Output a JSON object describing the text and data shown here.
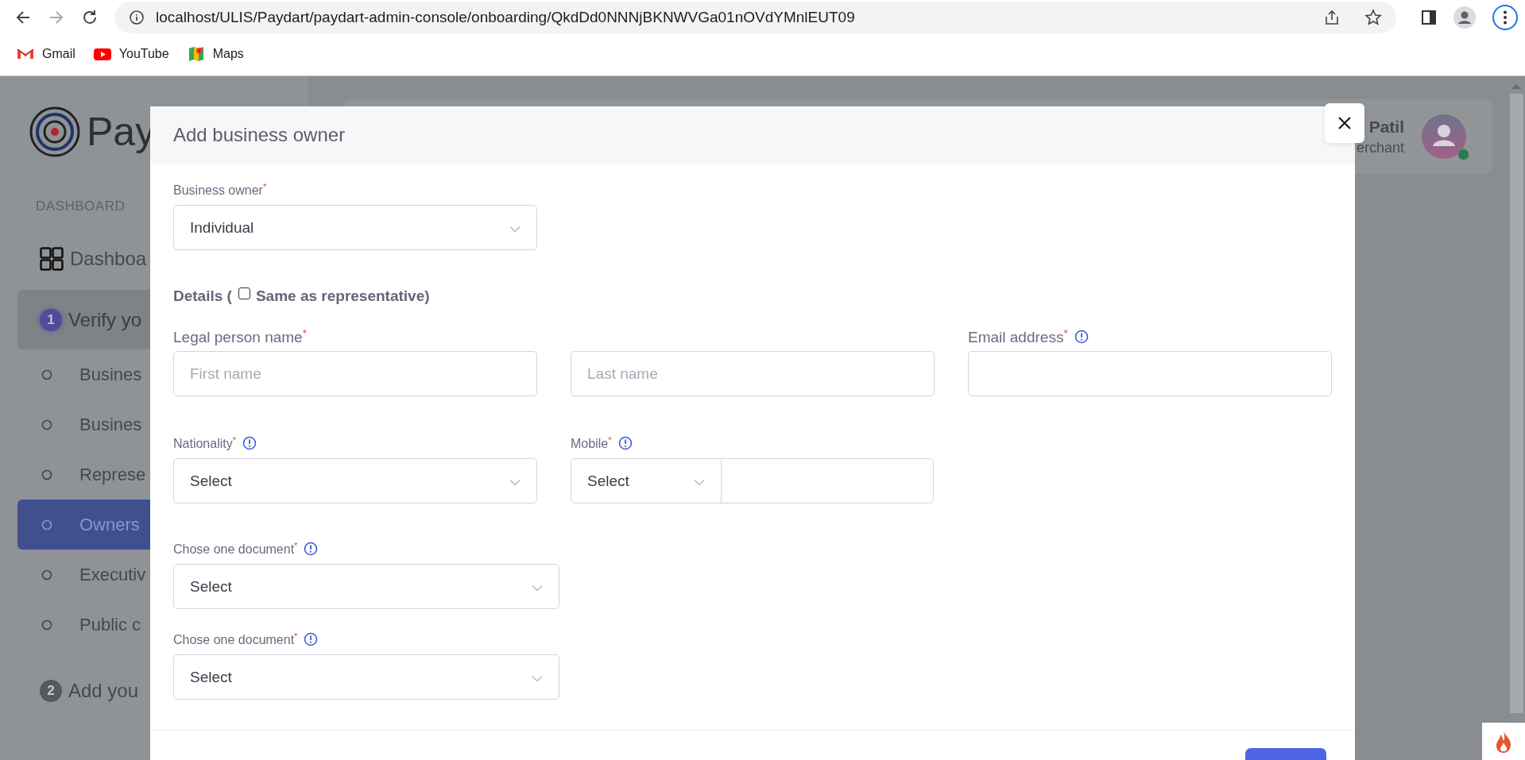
{
  "browser": {
    "url": "localhost/ULIS/Paydart/paydart-admin-console/onboarding/QkdDd0NNNjBKNWVGa01nOVdYMnlEUT09",
    "bookmarks": [
      {
        "label": "Gmail",
        "kind": "gmail"
      },
      {
        "label": "YouTube",
        "kind": "youtube"
      },
      {
        "label": "Maps",
        "kind": "maps"
      }
    ]
  },
  "sidebar": {
    "logo_text": "Pay",
    "section_title": "DASHBOARD",
    "items": [
      {
        "kind": "link",
        "label": "Dashboa"
      },
      {
        "kind": "step",
        "step": "1",
        "label": "Verify yo",
        "expanded": true
      },
      {
        "kind": "substep",
        "label": "Busines",
        "selected": false
      },
      {
        "kind": "substep",
        "label": "Busines",
        "selected": false
      },
      {
        "kind": "substep",
        "label": "Represe",
        "selected": false
      },
      {
        "kind": "substep",
        "label": "Owners",
        "selected": true
      },
      {
        "kind": "substep",
        "label": "Executiv",
        "selected": false
      },
      {
        "kind": "substep",
        "label": "Public c",
        "selected": false
      },
      {
        "kind": "step",
        "step": "2",
        "label": "Add you",
        "expanded": false
      }
    ]
  },
  "header": {
    "user_name": "Patil",
    "user_role": "erchant"
  },
  "modal": {
    "title": "Add business owner",
    "business_owner": {
      "label": "Business owner$^{*}$",
      "value": "Individual"
    },
    "details": {
      "label": "Details (",
      "checkbox_label": "Same as representative)",
      "checked": false
    },
    "legal_name": {
      "label": "Legal person name$^{*}$",
      "first_placeholder": "First name",
      "last_placeholder": "Last name"
    },
    "email": {
      "label": "Email address$^{*}$",
      "info": true
    },
    "nationality": {
      "label": "Nationality$^{*}$",
      "info": true,
      "value": "Select"
    },
    "mobile": {
      "label": "Mobile$^{*}$",
      "info": true,
      "code_value": "Select"
    },
    "documents": [
      {
        "label": "Chose one document$^{*}$",
        "info": true,
        "value": "Select"
      },
      {
        "label": "Chose one document$^{*}$",
        "info": true,
        "value": "Select"
      }
    ]
  }
}
